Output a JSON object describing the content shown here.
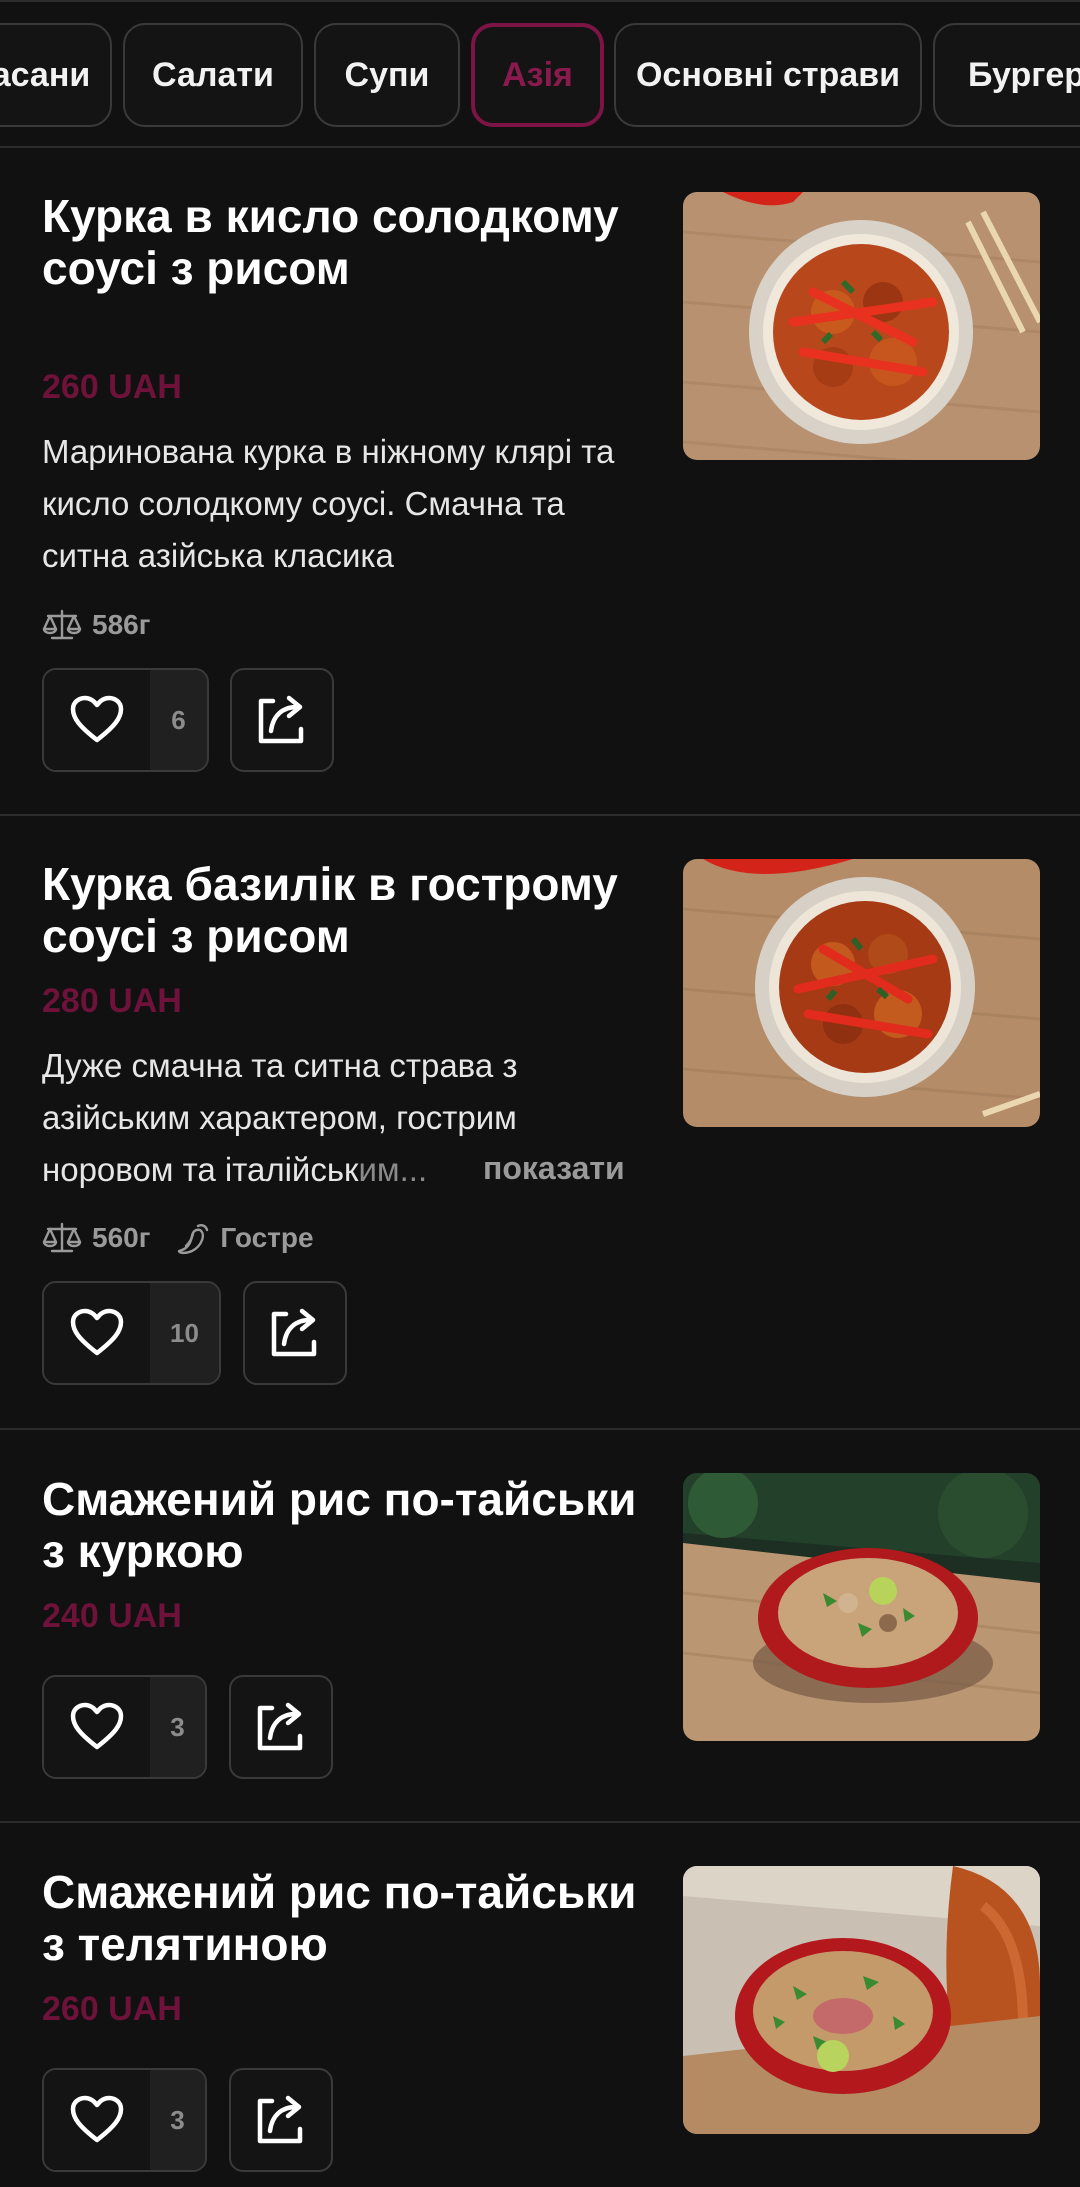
{
  "categories": {
    "tabs": [
      {
        "label": "асани"
      },
      {
        "label": "Салати"
      },
      {
        "label": "Супи"
      },
      {
        "label": "Азія",
        "active": true
      },
      {
        "label": "Основні страви"
      },
      {
        "label": "Бургери"
      }
    ]
  },
  "products": [
    {
      "title": "Курка в кисло солодкому соусі з рисом",
      "price": "260 UAH",
      "description": "Маринована курка в ніжному клярі та кисло солодкому соусі. Смачна та ситна азійська класика",
      "weight": "586г",
      "likes": "6"
    },
    {
      "title": "Курка базилік в гострому соусі з рисом",
      "price": "280 UAH",
      "description_visible": "Дуже смачна та ситна страва з азійським характером, гострим норовом та італійськ",
      "description_faded": "им...",
      "more_label": "показати",
      "weight": "560г",
      "tag": "Гостре",
      "likes": "10"
    },
    {
      "title": "Смажений рис по-тайськи з куркою",
      "price": "240 UAH",
      "likes": "3"
    },
    {
      "title": "Смажений рис по-тайськи з телятиною",
      "price": "260 UAH",
      "likes": "3"
    }
  ],
  "icons": {
    "like": "heart-icon",
    "share": "share-icon",
    "weight": "scales-icon",
    "spicy": "chili-pepper-icon"
  },
  "colors": {
    "background": "#111111",
    "accent": "#7c1446",
    "price": "#6e1239",
    "border": "#3a3a3a"
  }
}
